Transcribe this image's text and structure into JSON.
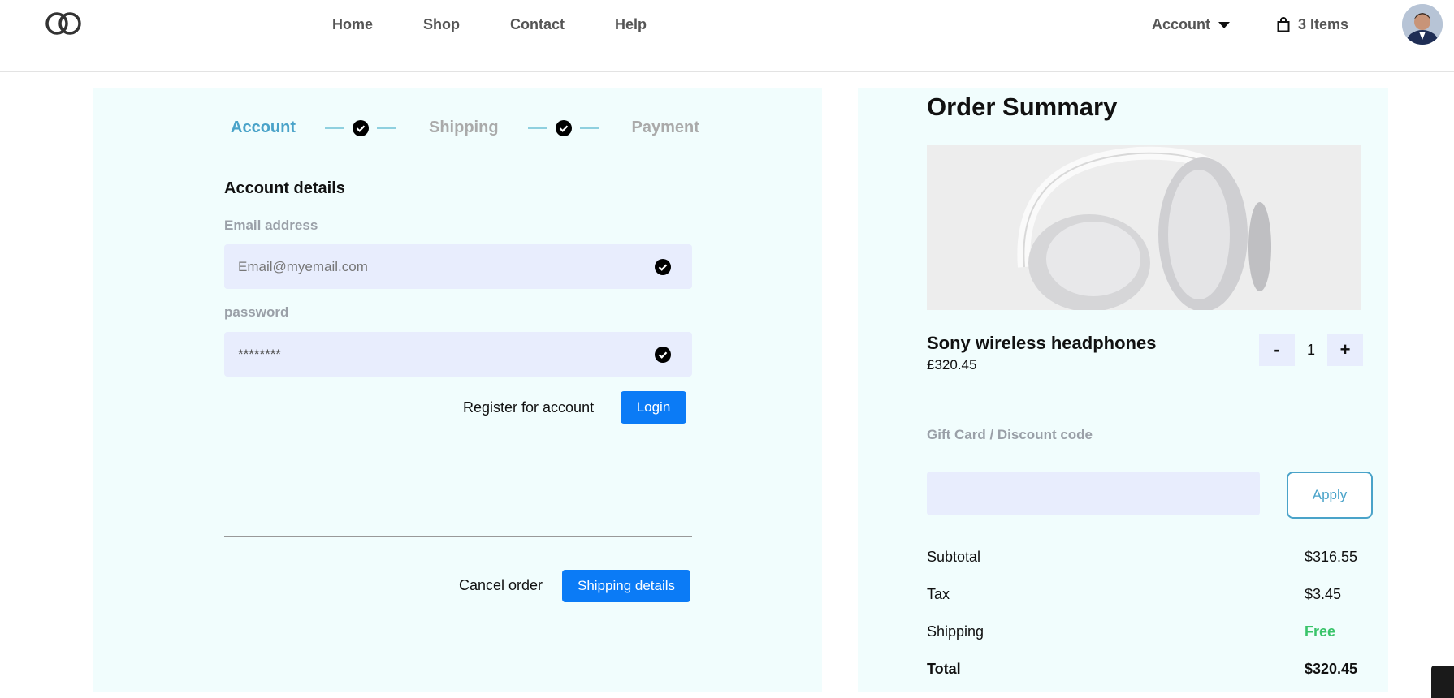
{
  "header": {
    "nav": [
      "Home",
      "Shop",
      "Contact",
      "Help"
    ],
    "account_label": "Account",
    "cart_label": "3 Items"
  },
  "stepper": {
    "steps": [
      "Account",
      "Shipping",
      "Payment"
    ],
    "active_step": "Account"
  },
  "account_form": {
    "title": "Account details",
    "email_label": "Email address",
    "email_placeholder": "Email@myemail.com",
    "password_label": "password",
    "password_value": "********",
    "register_label": "Register for account",
    "login_label": "Login",
    "cancel_label": "Cancel order",
    "next_label": "Shipping details"
  },
  "order_summary": {
    "title": "Order Summary",
    "product_name": "Sony wireless headphones",
    "product_price": "£320.45",
    "quantity": "1",
    "decrement_label": "-",
    "increment_label": "+",
    "gift_label": "Gift Card / Discount code",
    "gift_placeholder": "",
    "apply_label": "Apply",
    "totals": {
      "subtotal_label": "Subtotal",
      "subtotal_value": "$316.55",
      "tax_label": "Tax",
      "tax_value": "$3.45",
      "shipping_label": "Shipping",
      "shipping_value": "Free",
      "total_label": "Total",
      "total_value": "$320.45"
    }
  },
  "colors": {
    "accent": "#4aa3c9",
    "primary_button": "#0b7bf6",
    "panel_bg": "#f1fdfd",
    "input_bg": "#e8edfd",
    "free_green": "#3ac46a"
  }
}
